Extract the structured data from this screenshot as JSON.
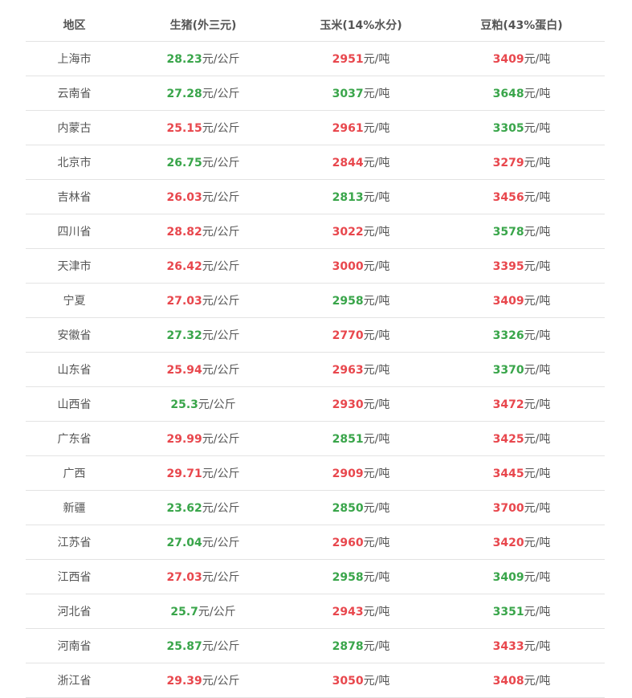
{
  "colors": {
    "up": "#e8474d",
    "down": "#39a54a",
    "text": "#555555",
    "border": "#e3e3e3"
  },
  "headers": [
    "地区",
    "生猪(外三元)",
    "玉米(14%水分)",
    "豆粕(43%蛋白)"
  ],
  "units": {
    "pig": "元/公斤",
    "corn": "元/吨",
    "meal": "元/吨"
  },
  "rows": [
    {
      "region": "上海市",
      "pig": "28.23",
      "pig_trend": "down",
      "corn": "2951",
      "corn_trend": "up",
      "meal": "3409",
      "meal_trend": "up"
    },
    {
      "region": "云南省",
      "pig": "27.28",
      "pig_trend": "down",
      "corn": "3037",
      "corn_trend": "down",
      "meal": "3648",
      "meal_trend": "down"
    },
    {
      "region": "内蒙古",
      "pig": "25.15",
      "pig_trend": "up",
      "corn": "2961",
      "corn_trend": "up",
      "meal": "3305",
      "meal_trend": "down"
    },
    {
      "region": "北京市",
      "pig": "26.75",
      "pig_trend": "down",
      "corn": "2844",
      "corn_trend": "up",
      "meal": "3279",
      "meal_trend": "up"
    },
    {
      "region": "吉林省",
      "pig": "26.03",
      "pig_trend": "up",
      "corn": "2813",
      "corn_trend": "down",
      "meal": "3456",
      "meal_trend": "up"
    },
    {
      "region": "四川省",
      "pig": "28.82",
      "pig_trend": "up",
      "corn": "3022",
      "corn_trend": "up",
      "meal": "3578",
      "meal_trend": "down"
    },
    {
      "region": "天津市",
      "pig": "26.42",
      "pig_trend": "up",
      "corn": "3000",
      "corn_trend": "up",
      "meal": "3395",
      "meal_trend": "up"
    },
    {
      "region": "宁夏",
      "pig": "27.03",
      "pig_trend": "up",
      "corn": "2958",
      "corn_trend": "down",
      "meal": "3409",
      "meal_trend": "up"
    },
    {
      "region": "安徽省",
      "pig": "27.32",
      "pig_trend": "down",
      "corn": "2770",
      "corn_trend": "up",
      "meal": "3326",
      "meal_trend": "down"
    },
    {
      "region": "山东省",
      "pig": "25.94",
      "pig_trend": "up",
      "corn": "2963",
      "corn_trend": "up",
      "meal": "3370",
      "meal_trend": "down"
    },
    {
      "region": "山西省",
      "pig": "25.3",
      "pig_trend": "down",
      "corn": "2930",
      "corn_trend": "up",
      "meal": "3472",
      "meal_trend": "up"
    },
    {
      "region": "广东省",
      "pig": "29.99",
      "pig_trend": "up",
      "corn": "2851",
      "corn_trend": "down",
      "meal": "3425",
      "meal_trend": "up"
    },
    {
      "region": "广西",
      "pig": "29.71",
      "pig_trend": "up",
      "corn": "2909",
      "corn_trend": "up",
      "meal": "3445",
      "meal_trend": "up"
    },
    {
      "region": "新疆",
      "pig": "23.62",
      "pig_trend": "down",
      "corn": "2850",
      "corn_trend": "down",
      "meal": "3700",
      "meal_trend": "up"
    },
    {
      "region": "江苏省",
      "pig": "27.04",
      "pig_trend": "down",
      "corn": "2960",
      "corn_trend": "up",
      "meal": "3420",
      "meal_trend": "up"
    },
    {
      "region": "江西省",
      "pig": "27.03",
      "pig_trend": "up",
      "corn": "2958",
      "corn_trend": "down",
      "meal": "3409",
      "meal_trend": "down"
    },
    {
      "region": "河北省",
      "pig": "25.7",
      "pig_trend": "down",
      "corn": "2943",
      "corn_trend": "up",
      "meal": "3351",
      "meal_trend": "down"
    },
    {
      "region": "河南省",
      "pig": "25.87",
      "pig_trend": "down",
      "corn": "2878",
      "corn_trend": "down",
      "meal": "3433",
      "meal_trend": "up"
    },
    {
      "region": "浙江省",
      "pig": "29.39",
      "pig_trend": "up",
      "corn": "3050",
      "corn_trend": "up",
      "meal": "3408",
      "meal_trend": "up"
    }
  ]
}
